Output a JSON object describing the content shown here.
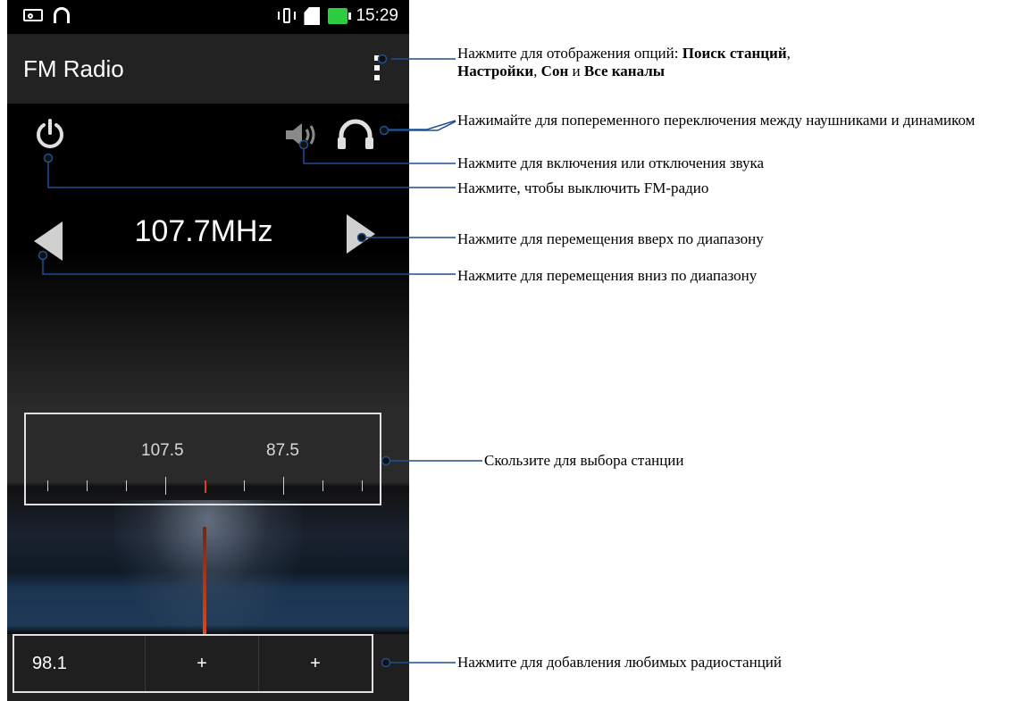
{
  "statusbar": {
    "time": "15:29"
  },
  "appbar": {
    "title": "FM Radio"
  },
  "tuner": {
    "frequency": "107.7MHz"
  },
  "dial": {
    "left_label": "107.5",
    "right_label": "87.5"
  },
  "favorites": [
    {
      "label": "98.1"
    },
    {
      "label": "+"
    },
    {
      "label": "+"
    }
  ],
  "icons": {
    "statusbar": [
      "mail-icon",
      "headset-icon",
      "vibrate-icon",
      "sd-card-icon",
      "battery-charging-icon"
    ],
    "menu": "overflow-menu-icon",
    "power": "power-icon",
    "speaker": "speaker-icon",
    "headphones": "headphones-icon",
    "prev": "arrow-left-icon",
    "next": "arrow-right-icon"
  },
  "callouts": {
    "menu": {
      "prefix": "Нажмите для отображения опций: ",
      "b1": "Поиск станций",
      "sep1": ",",
      "b2": "Настройки",
      "sep2": ", ",
      "b3": "Сон",
      "sep3": " и ",
      "b4": "Все каналы"
    },
    "headphones": "Нажимайте для попеременного переключения между наушниками и динамиком",
    "speaker": "Нажмите для включения или отключения звука",
    "power": "Нажмите, чтобы выключить FM-радио",
    "next": "Нажмите для перемещения вверх по диапазону",
    "prev": "Нажмите для перемещения вниз по диапазону",
    "dial": "Скользите для выбора станции",
    "favorites": "Нажмите для добавления любимых радиостанций"
  },
  "colors": {
    "needle": "#e0461e",
    "battery": "#2ecc40"
  }
}
